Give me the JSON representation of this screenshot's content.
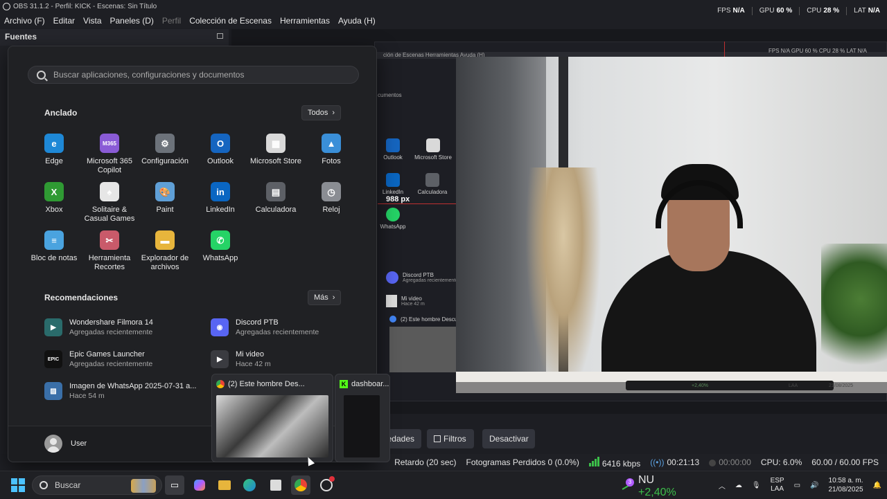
{
  "titlebar": {
    "text": "OBS 31.1.2 - Perfil: KICK - Escenas: Sin Título"
  },
  "menu": [
    {
      "label": "Archivo (F)",
      "dim": false
    },
    {
      "label": "Editar",
      "dim": false
    },
    {
      "label": "Vista",
      "dim": false
    },
    {
      "label": "Paneles (D)",
      "dim": false
    },
    {
      "label": "Perfil",
      "dim": true
    },
    {
      "label": "Colección de Escenas",
      "dim": false
    },
    {
      "label": "Herramientas",
      "dim": false
    },
    {
      "label": "Ayuda (H)",
      "dim": false
    }
  ],
  "top_stats": {
    "fps_label": "FPS",
    "fps_value": "N/A",
    "gpu_label": "GPU",
    "gpu_value": "60 %",
    "cpu_label": "CPU",
    "cpu_value": "28 %",
    "lat_label": "LAT",
    "lat_value": "N/A"
  },
  "left_panel": {
    "title": "Fuentes"
  },
  "nested_preview": {
    "menu_fragment": "ción de Escenas   Herramientas   Ayuda (H)",
    "stats": "FPS N/A   GPU 60 %   CPU 28 %   LAT N/A",
    "docs_fragment": "cumentos",
    "apps": [
      "Outlook",
      "Microsoft Store",
      "LinkedIn",
      "Calculadora",
      "WhatsApp"
    ],
    "px_label": "988 px",
    "recs": [
      {
        "name": "Discord PTB",
        "sub": "Agregadas recientemente"
      },
      {
        "name": "Mi video",
        "sub": "Hace 42 m"
      }
    ],
    "tab_fragment": "(2) Este hombre Descu",
    "cam_tray_pct": "+2,40%",
    "cam_tray_lang": "LAA",
    "cam_tray_date": "21/08/2025"
  },
  "start_menu": {
    "search_placeholder": "Buscar aplicaciones, configuraciones y documentos",
    "pinned_title": "Anclado",
    "all_label": "Todos",
    "pinned": [
      {
        "label": "Edge",
        "icon": "edge-icon",
        "color": "#1e88d6",
        "glyph": "e"
      },
      {
        "label": "Microsoft 365 Copilot",
        "icon": "m365-icon",
        "color": "#8a5bd6",
        "glyph": "M365"
      },
      {
        "label": "Configuración",
        "icon": "gear-icon",
        "color": "#6c727a",
        "glyph": "⚙"
      },
      {
        "label": "Outlook",
        "icon": "outlook-icon",
        "color": "#1565c0",
        "glyph": "O"
      },
      {
        "label": "Microsoft Store",
        "icon": "store-icon",
        "color": "#d9d9d9",
        "glyph": "▦"
      },
      {
        "label": "Fotos",
        "icon": "photos-icon",
        "color": "#3a8fd8",
        "glyph": "▲"
      },
      {
        "label": "Xbox",
        "icon": "xbox-icon",
        "color": "#2f9a33",
        "glyph": "X"
      },
      {
        "label": "Solitaire & Casual Games",
        "icon": "cards-icon",
        "color": "#e6e6e6",
        "glyph": "♠"
      },
      {
        "label": "Paint",
        "icon": "paint-icon",
        "color": "#5f9fd6",
        "glyph": "🎨"
      },
      {
        "label": "LinkedIn",
        "icon": "linkedin-icon",
        "color": "#0a66c2",
        "glyph": "in"
      },
      {
        "label": "Calculadora",
        "icon": "calculator-icon",
        "color": "#5d6066",
        "glyph": "▤"
      },
      {
        "label": "Reloj",
        "icon": "clock-icon",
        "color": "#8a8d93",
        "glyph": "◷"
      },
      {
        "label": "Bloc de notas",
        "icon": "notepad-icon",
        "color": "#4aa3df",
        "glyph": "≡"
      },
      {
        "label": "Herramienta Recortes",
        "icon": "snipping-icon",
        "color": "#c95a6a",
        "glyph": "✂"
      },
      {
        "label": "Explorador de archivos",
        "icon": "folder-icon",
        "color": "#e7b53c",
        "glyph": "▬"
      },
      {
        "label": "WhatsApp",
        "icon": "whatsapp-icon",
        "color": "#25d366",
        "glyph": "✆"
      }
    ],
    "recs_title": "Recomendaciones",
    "more_label": "Más",
    "recommendations": [
      {
        "name": "Wondershare Filmora 14",
        "sub": "Agregadas recientemente",
        "icon": "filmora-icon",
        "color": "#2a6b6b",
        "glyph": "▶"
      },
      {
        "name": "Discord PTB",
        "sub": "Agregadas recientemente",
        "icon": "discord-icon",
        "color": "#5865f2",
        "glyph": "◉"
      },
      {
        "name": "Epic Games Launcher",
        "sub": "Agregadas recientemente",
        "icon": "epic-icon",
        "color": "#111111",
        "glyph": "EPIC"
      },
      {
        "name": "Mi video",
        "sub": "Hace 42 m",
        "icon": "video-file-icon",
        "color": "#3a3b40",
        "glyph": "▶"
      },
      {
        "name": "Imagen de WhatsApp 2025-07-31 a...",
        "sub": "Hace 54 m",
        "icon": "image-file-icon",
        "color": "#3a6fa8",
        "glyph": "▨"
      }
    ],
    "user": "User"
  },
  "thumbnails": [
    {
      "title": "(2) Este hombre Des...",
      "icon": "chrome-icon"
    },
    {
      "title": "dashboar...",
      "icon": "kick-icon"
    }
  ],
  "obs_controls": {
    "properties_fragment": "edades",
    "filters": "Filtros",
    "deactivate": "Desactivar"
  },
  "obs_status": {
    "delay": "Retardo (20 sec)",
    "dropped": "Fotogramas Perdidos 0 (0.0%)",
    "bitrate": "6416 kbps",
    "stream_time": "00:21:13",
    "rec_time": "00:00:00",
    "cpu": "CPU: 6.0%",
    "fps": "60.00 / 60.00 FPS"
  },
  "taskbar": {
    "search": "Buscar",
    "stock_ticker": "NU",
    "stock_change": "+2,40%",
    "badge_count": "3",
    "lang_top": "ESP",
    "lang_bottom": "LAA",
    "time": "10:58 a. m.",
    "date": "21/08/2025"
  }
}
